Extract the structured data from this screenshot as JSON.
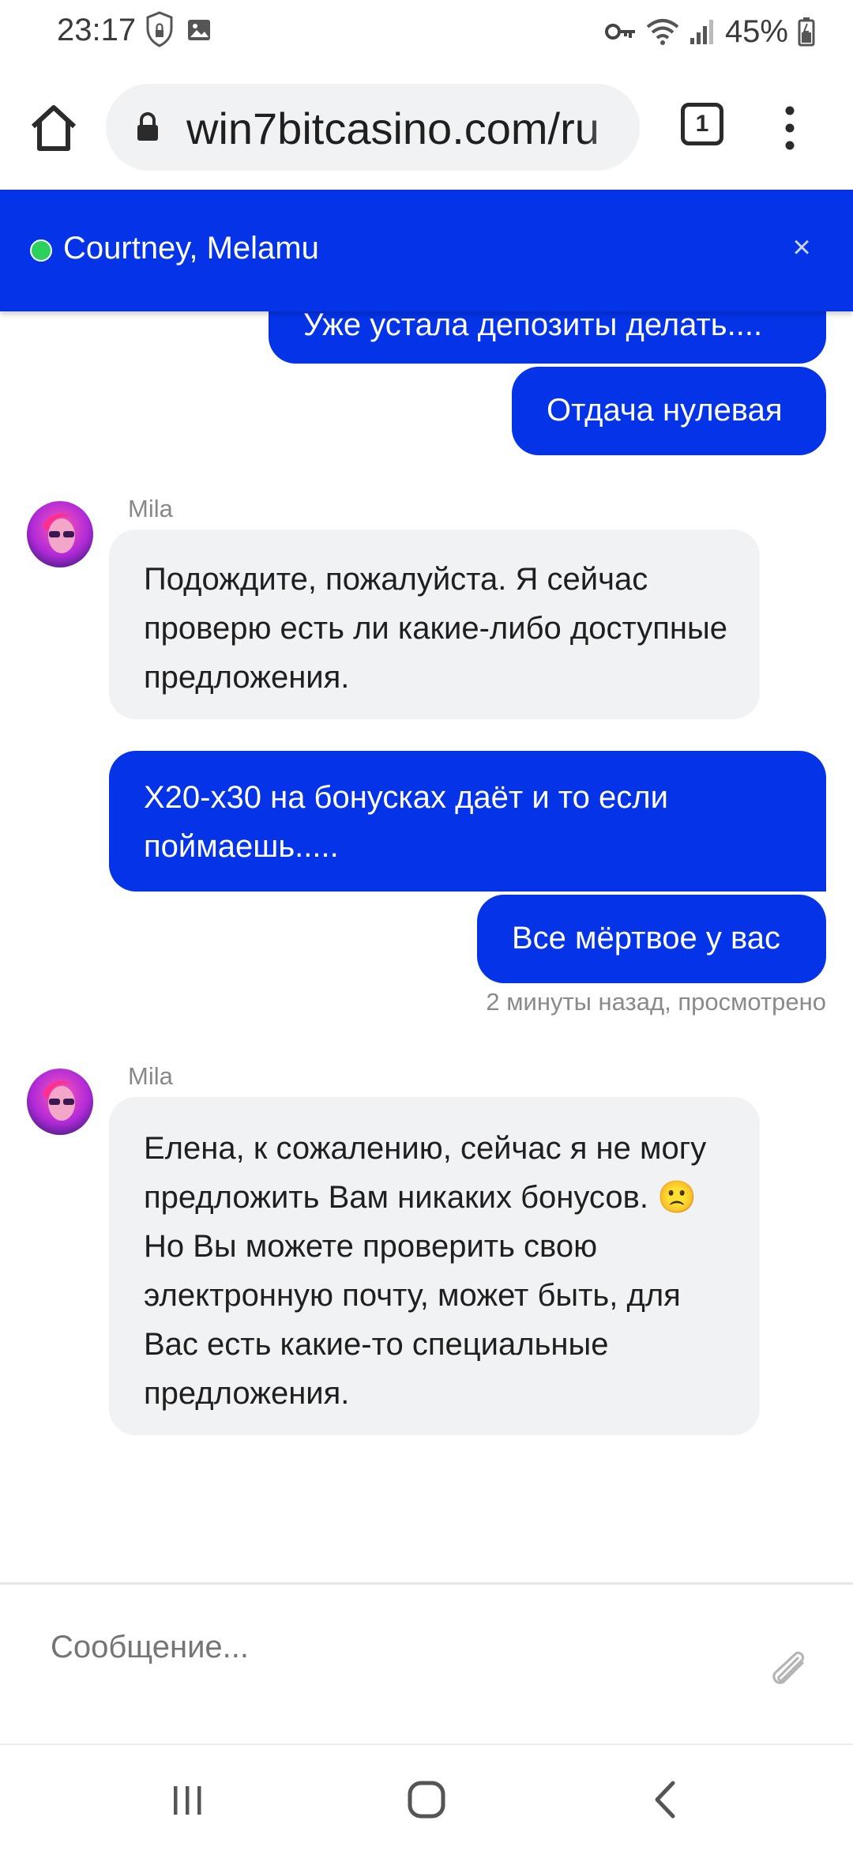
{
  "status_bar": {
    "time": "23:17",
    "battery": "45%",
    "icons": [
      "vpn-shield-icon",
      "gallery-icon",
      "key-icon",
      "wifi-icon",
      "signal-icon",
      "battery-icon"
    ]
  },
  "browser": {
    "url": "win7bitcasino.com/ru",
    "tab_count": "1",
    "icons": [
      "home-icon",
      "lock-icon",
      "more-vert-icon"
    ]
  },
  "chat": {
    "title": "Courtney, Melamu",
    "close_label": "×",
    "messages": [
      {
        "from": "me",
        "text": "Уже устала депозиты делать...."
      },
      {
        "from": "me",
        "text": "Отдача нулевая"
      },
      {
        "from": "agent",
        "sender": "Mila",
        "text": "Подождите, пожалуйста. Я сейчас проверю есть ли какие-либо доступные предложения."
      },
      {
        "from": "me",
        "text": "X20-x30 на бонусках даёт и то если поймаешь....."
      },
      {
        "from": "me",
        "text": "Все мёртвое у вас"
      },
      {
        "from": "agent",
        "sender": "Mila",
        "text": "Елена, к сожалению, сейчас я не могу предложить Вам никаких бонусов. 🙁 Но Вы можете проверить свою электронную почту, может быть, для Вас есть какие-то специальные предложения."
      }
    ],
    "read_status": "2 минуты назад, просмотрено"
  },
  "composer": {
    "placeholder": "Сообщение..."
  },
  "colors": {
    "brand_blue": "#0433e8",
    "incoming_bg": "#f1f2f4",
    "online_green": "#2bd15a"
  }
}
